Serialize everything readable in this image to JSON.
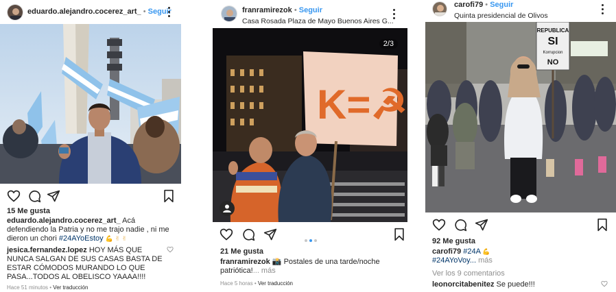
{
  "posts": [
    {
      "username": "eduardo.alejandro.cocerez_art_",
      "separator": "•",
      "follow": "Seguir",
      "location": "",
      "likes": "15 Me gusta",
      "caption_user": "eduardo.alejandro.cocerez_art_",
      "caption_text": "Acá defendiendo la Patria y no me trajo nadie , ni me dieron un chori",
      "caption_tags": "#24AYoEstoy",
      "caption_emoji": "💪 ✌ ✌",
      "comment_user": "jesica.fernandez.lopez",
      "comment_text": "HOY MÁS QUE NUNCA SALGAN DE SUS CASAS BASTA DE ESTAR CÓMODOS MURANDO LO QUE PASA...TODOS AL OBELISCO YAAAA!!!!",
      "time": "Hace 51 minutos",
      "translate": "Ver traducción"
    },
    {
      "username": "franramirezok",
      "separator": "•",
      "follow": "Seguir",
      "location": "Casa Rosada Plaza de Mayo Buenos Aires G...",
      "counter": "2/3",
      "sign_text": "K=☭",
      "likes": "21 Me gusta",
      "caption_user": "franramirezok",
      "caption_text": "📸 Postales de una tarde/noche patriótica!",
      "caption_more": "... más",
      "time": "Hace 5 horas",
      "translate": "Ver traducción"
    },
    {
      "username": "carofi79",
      "separator": "•",
      "follow": "Seguir",
      "location": "Quinta presidencial de Olivos",
      "sign_lines": [
        "REPUBLICA",
        "SI",
        "Korrupcion",
        "NO"
      ],
      "likes": "92 Me gusta",
      "caption_user": "carofi79",
      "caption_tags": "#24A",
      "caption_emoji": "💪",
      "caption_tags2": "#24AYoVoy...",
      "caption_more": "más",
      "view_comments": "Ver los 9 comentarios",
      "comment_user": "leonorcitabenitez",
      "comment_text": "Se puede!!!"
    }
  ],
  "icons": [
    "avatar",
    "more-options-icon",
    "heart-icon",
    "comment-icon",
    "share-icon",
    "bookmark-icon",
    "carousel-dots",
    "small-heart-icon"
  ],
  "colors": {
    "link": "#3897f0",
    "hashtag": "#003569",
    "muted": "#8e8e8e",
    "text": "#262626"
  }
}
